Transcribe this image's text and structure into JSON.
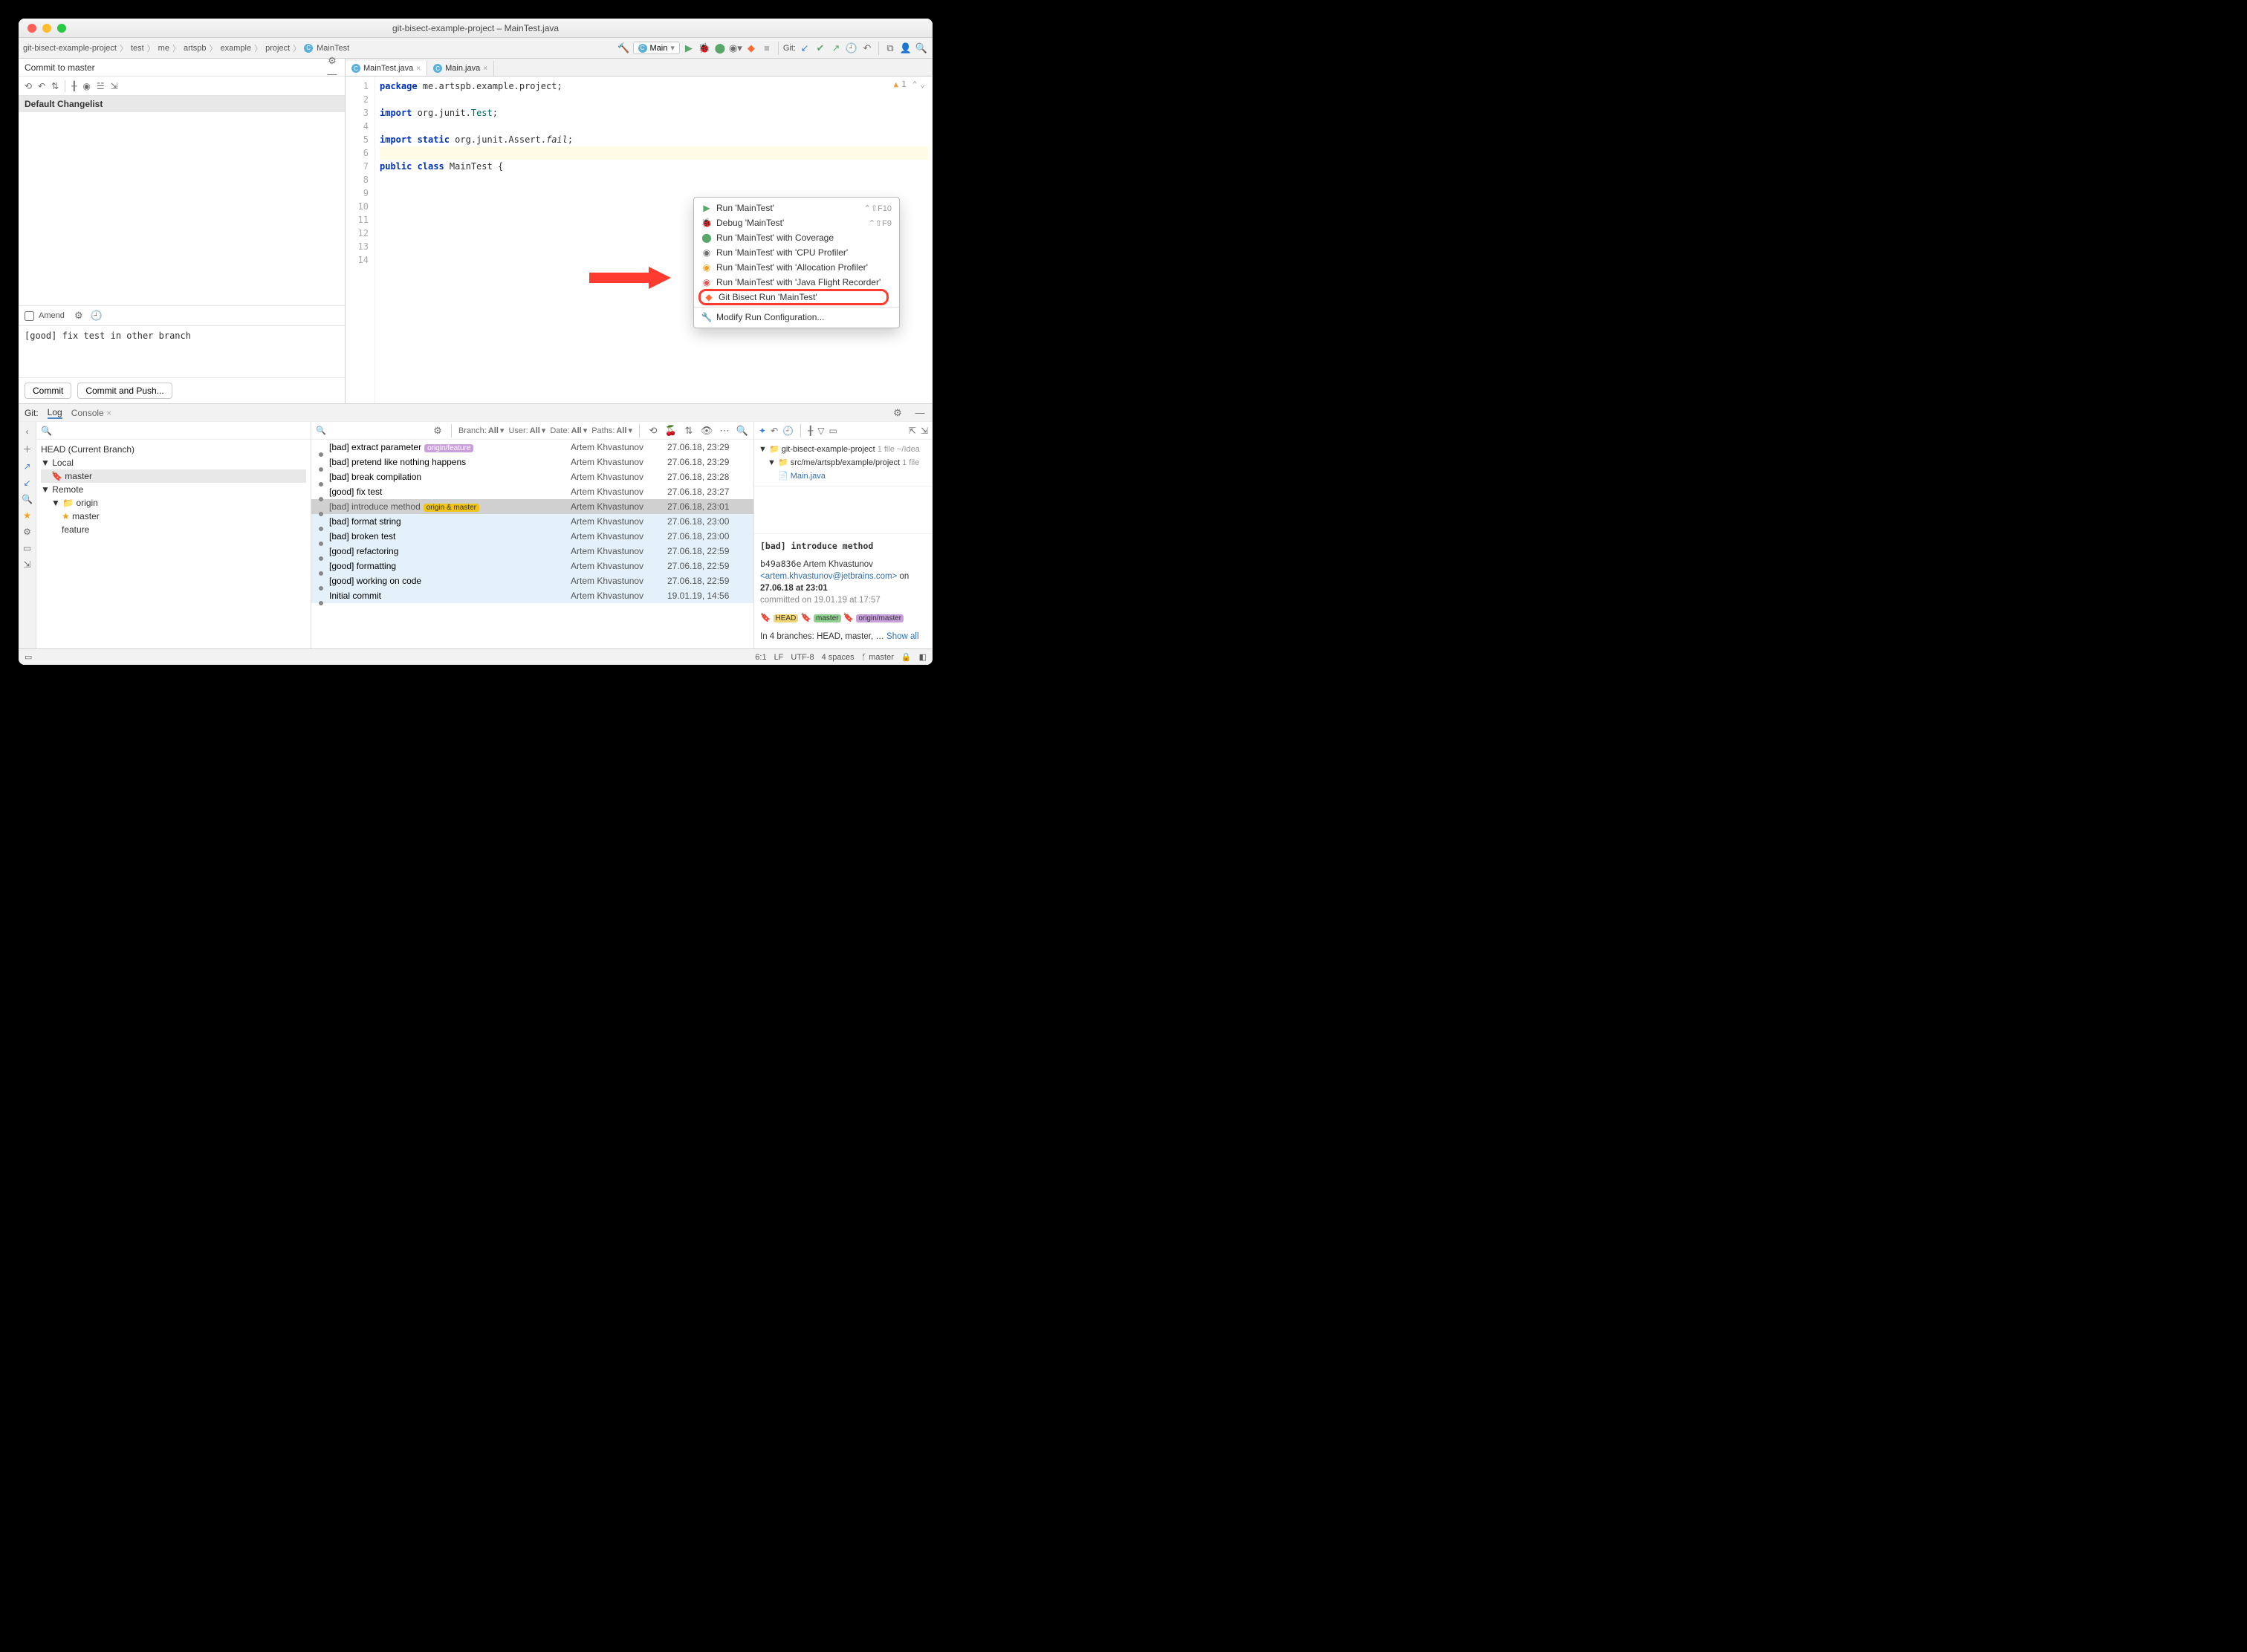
{
  "title": "git-bisect-example-project – MainTest.java",
  "breadcrumbs": [
    "git-bisect-example-project",
    "test",
    "me",
    "artspb",
    "example",
    "project",
    "MainTest"
  ],
  "run_config": "Main",
  "git_label": "Git:",
  "inspection_count": "1",
  "commit_panel": {
    "header": "Commit to master",
    "changelist": "Default Changelist",
    "amend": "Amend",
    "message": "[good] fix test in other branch",
    "commit_btn": "Commit",
    "push_btn": "Commit and Push..."
  },
  "tabs": [
    {
      "name": "MainTest.java",
      "active": true
    },
    {
      "name": "Main.java",
      "active": false
    }
  ],
  "code": {
    "lines": [
      {
        "n": "1",
        "html": "<span class='kw'>package</span> me.artspb.example.project;"
      },
      {
        "n": "2",
        "html": ""
      },
      {
        "n": "3",
        "html": "<span class='kw'>import</span> org.junit.<span class='cls'>Test</span>;"
      },
      {
        "n": "4",
        "html": ""
      },
      {
        "n": "5",
        "html": "<span class='kw'>import static</span> org.junit.Assert.<span class='mth'>fail</span>;"
      },
      {
        "n": "6",
        "html": "",
        "hl": true
      },
      {
        "n": "7",
        "html": "<span class='kw'>public class</span> MainTest {"
      },
      {
        "n": "8",
        "html": ""
      },
      {
        "n": "9",
        "html": ""
      },
      {
        "n": "10",
        "html": ""
      },
      {
        "n": "11",
        "html": ""
      },
      {
        "n": "12",
        "html": ""
      },
      {
        "n": "13",
        "html": ""
      },
      {
        "n": "14",
        "html": ""
      }
    ]
  },
  "context_menu": [
    {
      "icon": "▶",
      "color": "#59a869",
      "label": "Run 'MainTest'",
      "shortcut": "⌃⇧F10"
    },
    {
      "icon": "🐞",
      "color": "#59a869",
      "label": "Debug 'MainTest'",
      "shortcut": "⌃⇧F9"
    },
    {
      "icon": "⬤",
      "color": "#59a869",
      "label": "Run 'MainTest' with Coverage"
    },
    {
      "icon": "◉",
      "color": "#6e6e6e",
      "label": "Run 'MainTest' with 'CPU Profiler'"
    },
    {
      "icon": "◉",
      "color": "#f0a020",
      "label": "Run 'MainTest' with 'Allocation Profiler'"
    },
    {
      "icon": "◉",
      "color": "#e05555",
      "label": "Run 'MainTest' with 'Java Flight Recorder'"
    },
    {
      "icon": "◆",
      "color": "#ff6b35",
      "label": "Git Bisect Run 'MainTest'",
      "highlighted": true
    },
    {
      "sep": true
    },
    {
      "icon": "🔧",
      "color": "#6e6e6e",
      "label": "Modify Run Configuration..."
    }
  ],
  "bottom_tabs": {
    "git": "Git:",
    "log": "Log",
    "console": "Console"
  },
  "branches": {
    "head": "HEAD (Current Branch)",
    "local": "Local",
    "local_items": [
      "master"
    ],
    "remote": "Remote",
    "remote_group": "origin",
    "remote_items": [
      "master",
      "feature"
    ]
  },
  "commits_filters": {
    "branch": "Branch:",
    "branch_v": "All",
    "user": "User:",
    "user_v": "All",
    "date": "Date:",
    "date_v": "All",
    "paths": "Paths:",
    "paths_v": "All"
  },
  "commits": [
    {
      "msg": "[bad] extract parameter",
      "author": "Artem Khvastunov",
      "date": "27.06.18, 23:29",
      "tag": "origin/feature",
      "tagcls": "tag-origin"
    },
    {
      "msg": "[bad] pretend like nothing happens",
      "author": "Artem Khvastunov",
      "date": "27.06.18, 23:29"
    },
    {
      "msg": "[bad] break compilation",
      "author": "Artem Khvastunov",
      "date": "27.06.18, 23:28"
    },
    {
      "msg": "[good] fix test",
      "author": "Artem Khvastunov",
      "date": "27.06.18, 23:27"
    },
    {
      "msg": "[bad] introduce method",
      "author": "Artem Khvastunov",
      "date": "27.06.18, 23:01",
      "sel": true,
      "tag": "origin & master",
      "tagcls": "tag-om"
    },
    {
      "msg": "[bad] format string",
      "author": "Artem Khvastunov",
      "date": "27.06.18, 23:00",
      "hl": true
    },
    {
      "msg": "[bad] broken test",
      "author": "Artem Khvastunov",
      "date": "27.06.18, 23:00",
      "hl": true
    },
    {
      "msg": "[good] refactoring",
      "author": "Artem Khvastunov",
      "date": "27.06.18, 22:59",
      "hl": true
    },
    {
      "msg": "[good] formatting",
      "author": "Artem Khvastunov",
      "date": "27.06.18, 22:59",
      "hl": true
    },
    {
      "msg": "[good] working on code",
      "author": "Artem Khvastunov",
      "date": "27.06.18, 22:59",
      "hl": true
    },
    {
      "msg": "Initial commit",
      "author": "Artem Khvastunov",
      "date": "19.01.19, 14:56",
      "hl": true
    }
  ],
  "file_tree": {
    "root": "git-bisect-example-project",
    "root_meta": "1 file  ~/Idea",
    "sub": "src/me/artspb/example/project",
    "sub_meta": "1 file",
    "file": "Main.java"
  },
  "commit_detail": {
    "title": "[bad] introduce method",
    "hash": "b49a836e",
    "author": "Artem Khvastunov",
    "email": "<artem.khvastunov@jetbrains.com>",
    "on": "on",
    "datetime": "27.06.18 at 23:01",
    "committed": "committed on 19.01.19 at 17:57",
    "tags": {
      "head": "HEAD",
      "master": "master",
      "om": "origin/master"
    },
    "branches_pre": "In 4 branches: HEAD, master, …",
    "show_all": "Show all"
  },
  "statusbar": {
    "pos": "6:1",
    "lf": "LF",
    "enc": "UTF-8",
    "indent": "4 spaces",
    "branch": "master"
  }
}
